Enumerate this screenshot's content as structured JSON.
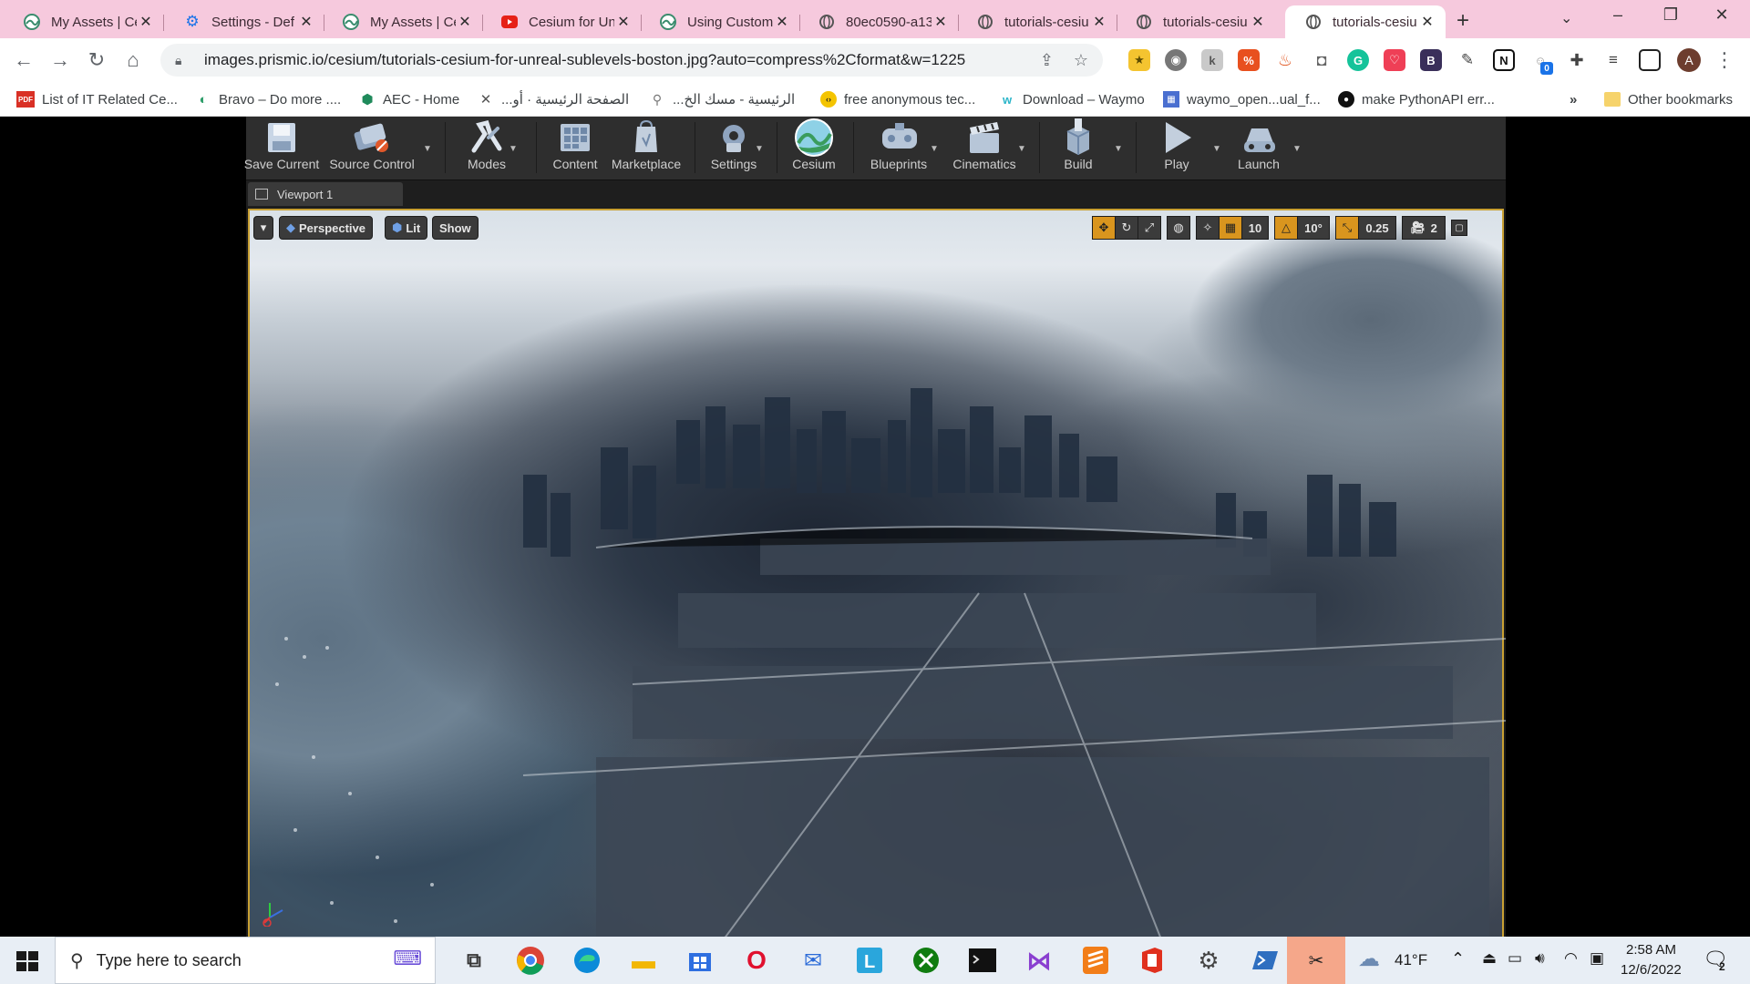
{
  "browser": {
    "tabs": [
      {
        "title": "My Assets | Ce",
        "favicon": "cesium-icon"
      },
      {
        "title": "Settings - Def",
        "favicon": "gear-icon"
      },
      {
        "title": "My Assets | Ce",
        "favicon": "cesium-icon"
      },
      {
        "title": "Cesium for Un",
        "favicon": "youtube-icon"
      },
      {
        "title": "Using Custom",
        "favicon": "cesium-icon"
      },
      {
        "title": "80ec0590-a13",
        "favicon": "globe-icon"
      },
      {
        "title": "tutorials-cesiu",
        "favicon": "globe-icon"
      },
      {
        "title": "tutorials-cesiu",
        "favicon": "globe-icon"
      },
      {
        "title": "tutorials-cesiu",
        "favicon": "globe-icon",
        "active": true
      }
    ],
    "url": "images.prismic.io/cesium/tutorials-cesium-for-unreal-sublevels-boston.jpg?auto=compress%2Cformat&w=1225",
    "avatar_letter": "A",
    "extension_badge": "0",
    "bookmarks": [
      {
        "label": "List of IT Related Ce...",
        "icon": "pdf-icon",
        "icon_text": "PDF"
      },
      {
        "label": "Bravo – Do more ....",
        "icon": "bravo-icon"
      },
      {
        "label": "AEC - Home",
        "icon": "aec-icon"
      },
      {
        "label": "الصفحة الرئيسية · أو...",
        "icon": "cross-icon"
      },
      {
        "label": "الرئيسية - مسك الخ...",
        "icon": "location-icon"
      },
      {
        "label": "free anonymous tec...",
        "icon": "code-icon"
      },
      {
        "label": "Download – Waymo",
        "icon": "waymo-icon"
      },
      {
        "label": "waymo_open...ual_f...",
        "icon": "grid-icon"
      },
      {
        "label": "make PythonAPI err...",
        "icon": "github-icon"
      }
    ],
    "more_bookmarks": "»",
    "other_bookmarks": "Other bookmarks"
  },
  "editor": {
    "toolbar": [
      {
        "label": "Save Current",
        "icon": "save-icon",
        "dropdown": false
      },
      {
        "label": "Source Control",
        "icon": "source-control-icon",
        "dropdown": true
      },
      {
        "label": "Modes",
        "icon": "modes-icon",
        "dropdown": true
      },
      {
        "label": "Content",
        "icon": "content-icon",
        "dropdown": false
      },
      {
        "label": "Marketplace",
        "icon": "marketplace-icon",
        "dropdown": false
      },
      {
        "label": "Settings",
        "icon": "settings-icon",
        "dropdown": true
      },
      {
        "label": "Cesium",
        "icon": "cesium-icon",
        "dropdown": false
      },
      {
        "label": "Blueprints",
        "icon": "blueprints-icon",
        "dropdown": true
      },
      {
        "label": "Cinematics",
        "icon": "cinematics-icon",
        "dropdown": true
      },
      {
        "label": "Build",
        "icon": "build-icon",
        "dropdown": true
      },
      {
        "label": "Play",
        "icon": "play-icon",
        "dropdown": true
      },
      {
        "label": "Launch",
        "icon": "launch-icon",
        "dropdown": true
      }
    ],
    "viewport_tab": "Viewport 1",
    "viewport_controls": {
      "perspective": "Perspective",
      "lit": "Lit",
      "show": "Show",
      "grid_snap": "10",
      "rotation_snap": "10°",
      "scale_snap": "0.25",
      "camera_speed": "2"
    }
  },
  "taskbar": {
    "search_placeholder": "Type here to search",
    "weather": "41°F",
    "time": "2:58 AM",
    "date": "12/6/2022",
    "notification_count": "2"
  },
  "colors": {
    "tab_strip": "#f6c9dd",
    "viewport_border": "#c8a033",
    "ue_toolbar": "#2e2e2e",
    "active_taskbar_app": "#f5a78a"
  }
}
